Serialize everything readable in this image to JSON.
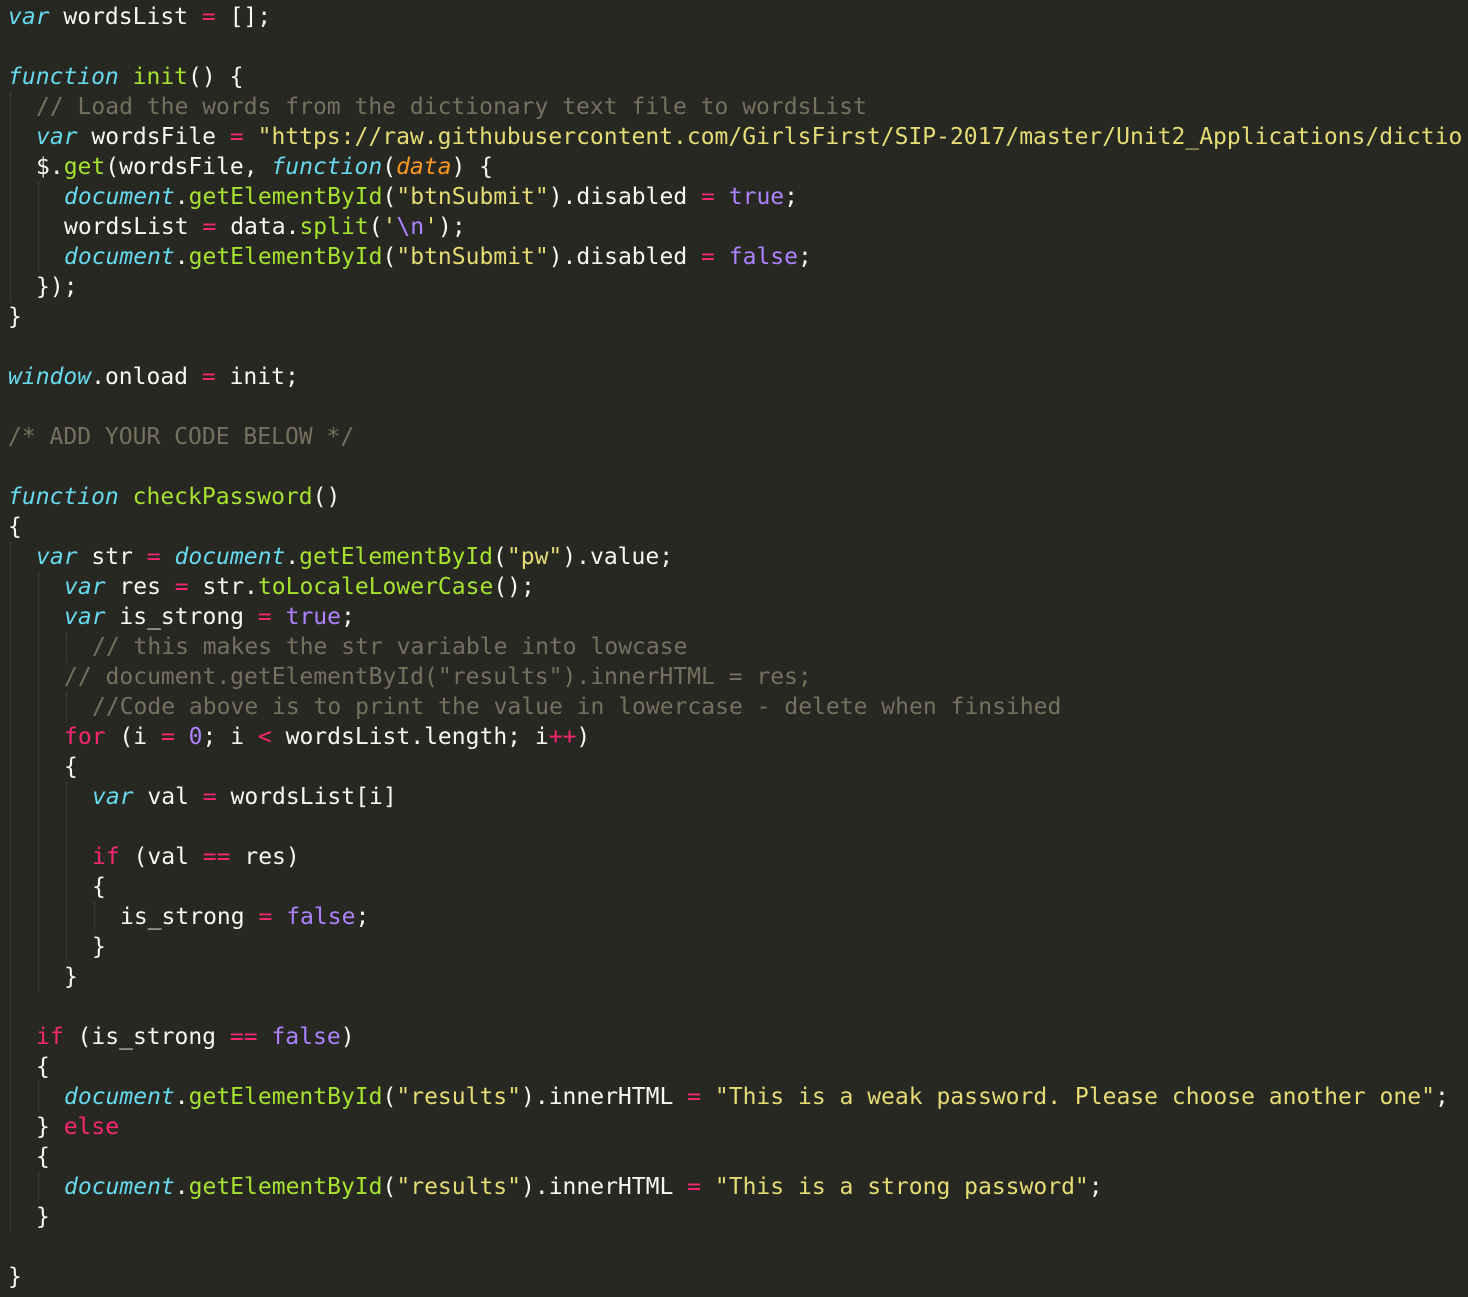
{
  "colors": {
    "background": "#272822",
    "text": "#F8F8F2",
    "storage": "#66D9EF",
    "function_name": "#A6E22E",
    "operator": "#F92672",
    "string": "#E6DB74",
    "constant": "#AE81FF",
    "comment": "#75715E",
    "parameter": "#FD971F"
  },
  "editor": {
    "lines": [
      {
        "indent": 0,
        "tokens": [
          {
            "t": "kw",
            "v": "var"
          },
          {
            "t": "plain",
            "v": " wordsList "
          },
          {
            "t": "op",
            "v": "="
          },
          {
            "t": "plain",
            "v": " [];"
          }
        ]
      },
      {
        "indent": 0,
        "tokens": []
      },
      {
        "indent": 0,
        "tokens": [
          {
            "t": "kw",
            "v": "function"
          },
          {
            "t": "plain",
            "v": " "
          },
          {
            "t": "fn",
            "v": "init"
          },
          {
            "t": "plain",
            "v": "() {"
          }
        ]
      },
      {
        "indent": 1,
        "tokens": [
          {
            "t": "cm",
            "v": "// Load the words from the dictionary text file to wordsList"
          }
        ]
      },
      {
        "indent": 1,
        "tokens": [
          {
            "t": "kw",
            "v": "var"
          },
          {
            "t": "plain",
            "v": " wordsFile "
          },
          {
            "t": "op",
            "v": "="
          },
          {
            "t": "plain",
            "v": " "
          },
          {
            "t": "str",
            "v": "\"https://raw.githubusercontent.com/GirlsFirst/SIP-2017/master/Unit2_Applications/dictio"
          }
        ]
      },
      {
        "indent": 1,
        "tokens": [
          {
            "t": "plain",
            "v": "$."
          },
          {
            "t": "fn",
            "v": "get"
          },
          {
            "t": "plain",
            "v": "(wordsFile, "
          },
          {
            "t": "kw",
            "v": "function"
          },
          {
            "t": "plain",
            "v": "("
          },
          {
            "t": "par",
            "v": "data"
          },
          {
            "t": "plain",
            "v": ") {"
          }
        ]
      },
      {
        "indent": 2,
        "tokens": [
          {
            "t": "kw",
            "v": "document"
          },
          {
            "t": "plain",
            "v": "."
          },
          {
            "t": "fn",
            "v": "getElementById"
          },
          {
            "t": "plain",
            "v": "("
          },
          {
            "t": "str",
            "v": "\"btnSubmit\""
          },
          {
            "t": "plain",
            "v": ").disabled "
          },
          {
            "t": "op",
            "v": "="
          },
          {
            "t": "plain",
            "v": " "
          },
          {
            "t": "num",
            "v": "true"
          },
          {
            "t": "plain",
            "v": ";"
          }
        ]
      },
      {
        "indent": 2,
        "tokens": [
          {
            "t": "plain",
            "v": "wordsList "
          },
          {
            "t": "op",
            "v": "="
          },
          {
            "t": "plain",
            "v": " data."
          },
          {
            "t": "fn",
            "v": "split"
          },
          {
            "t": "plain",
            "v": "("
          },
          {
            "t": "str",
            "v": "'"
          },
          {
            "t": "num",
            "v": "\\n"
          },
          {
            "t": "str",
            "v": "'"
          },
          {
            "t": "plain",
            "v": ");"
          }
        ]
      },
      {
        "indent": 2,
        "tokens": [
          {
            "t": "kw",
            "v": "document"
          },
          {
            "t": "plain",
            "v": "."
          },
          {
            "t": "fn",
            "v": "getElementById"
          },
          {
            "t": "plain",
            "v": "("
          },
          {
            "t": "str",
            "v": "\"btnSubmit\""
          },
          {
            "t": "plain",
            "v": ").disabled "
          },
          {
            "t": "op",
            "v": "="
          },
          {
            "t": "plain",
            "v": " "
          },
          {
            "t": "num",
            "v": "false"
          },
          {
            "t": "plain",
            "v": ";"
          }
        ]
      },
      {
        "indent": 1,
        "tokens": [
          {
            "t": "plain",
            "v": "});"
          }
        ]
      },
      {
        "indent": 0,
        "tokens": [
          {
            "t": "plain",
            "v": "}"
          }
        ]
      },
      {
        "indent": 0,
        "tokens": []
      },
      {
        "indent": 0,
        "tokens": [
          {
            "t": "kw",
            "v": "window"
          },
          {
            "t": "plain",
            "v": ".onload "
          },
          {
            "t": "op",
            "v": "="
          },
          {
            "t": "plain",
            "v": " init;"
          }
        ]
      },
      {
        "indent": 0,
        "tokens": []
      },
      {
        "indent": 0,
        "tokens": [
          {
            "t": "cm",
            "v": "/* ADD YOUR CODE BELOW */"
          }
        ]
      },
      {
        "indent": 0,
        "tokens": []
      },
      {
        "indent": 0,
        "tokens": [
          {
            "t": "kw",
            "v": "function"
          },
          {
            "t": "plain",
            "v": " "
          },
          {
            "t": "fn",
            "v": "checkPassword"
          },
          {
            "t": "plain",
            "v": "()"
          }
        ]
      },
      {
        "indent": 0,
        "tokens": [
          {
            "t": "plain",
            "v": "{"
          }
        ]
      },
      {
        "indent": 1,
        "tokens": [
          {
            "t": "kw",
            "v": "var"
          },
          {
            "t": "plain",
            "v": " str "
          },
          {
            "t": "op",
            "v": "="
          },
          {
            "t": "plain",
            "v": " "
          },
          {
            "t": "kw",
            "v": "document"
          },
          {
            "t": "plain",
            "v": "."
          },
          {
            "t": "fn",
            "v": "getElementById"
          },
          {
            "t": "plain",
            "v": "("
          },
          {
            "t": "str",
            "v": "\"pw\""
          },
          {
            "t": "plain",
            "v": ").value;"
          }
        ]
      },
      {
        "indent": 2,
        "tokens": [
          {
            "t": "kw",
            "v": "var"
          },
          {
            "t": "plain",
            "v": " res "
          },
          {
            "t": "op",
            "v": "="
          },
          {
            "t": "plain",
            "v": " str."
          },
          {
            "t": "fn",
            "v": "toLocaleLowerCase"
          },
          {
            "t": "plain",
            "v": "();"
          }
        ]
      },
      {
        "indent": 2,
        "tokens": [
          {
            "t": "kw",
            "v": "var"
          },
          {
            "t": "plain",
            "v": " is_strong "
          },
          {
            "t": "op",
            "v": "="
          },
          {
            "t": "plain",
            "v": " "
          },
          {
            "t": "num",
            "v": "true"
          },
          {
            "t": "plain",
            "v": ";"
          }
        ]
      },
      {
        "indent": 3,
        "tokens": [
          {
            "t": "cm",
            "v": "// this makes the str variable into lowcase"
          }
        ]
      },
      {
        "indent": 2,
        "tokens": [
          {
            "t": "cm",
            "v": "// document.getElementById(\"results\").innerHTML = res;"
          }
        ]
      },
      {
        "indent": 3,
        "tokens": [
          {
            "t": "cm",
            "v": "//Code above is to print the value in lowercase - delete when finsihed"
          }
        ]
      },
      {
        "indent": 2,
        "tokens": [
          {
            "t": "op",
            "v": "for"
          },
          {
            "t": "plain",
            "v": " (i "
          },
          {
            "t": "op",
            "v": "="
          },
          {
            "t": "plain",
            "v": " "
          },
          {
            "t": "num",
            "v": "0"
          },
          {
            "t": "plain",
            "v": "; i "
          },
          {
            "t": "op",
            "v": "<"
          },
          {
            "t": "plain",
            "v": " wordsList.length; i"
          },
          {
            "t": "op",
            "v": "++"
          },
          {
            "t": "plain",
            "v": ")"
          }
        ]
      },
      {
        "indent": 2,
        "tokens": [
          {
            "t": "plain",
            "v": "{"
          }
        ]
      },
      {
        "indent": 3,
        "tokens": [
          {
            "t": "kw",
            "v": "var"
          },
          {
            "t": "plain",
            "v": " val "
          },
          {
            "t": "op",
            "v": "="
          },
          {
            "t": "plain",
            "v": " wordsList[i]"
          }
        ]
      },
      {
        "indent": 0,
        "tokens": []
      },
      {
        "indent": 3,
        "tokens": [
          {
            "t": "op",
            "v": "if"
          },
          {
            "t": "plain",
            "v": " (val "
          },
          {
            "t": "op",
            "v": "=="
          },
          {
            "t": "plain",
            "v": " res)"
          }
        ]
      },
      {
        "indent": 3,
        "tokens": [
          {
            "t": "plain",
            "v": "{"
          }
        ]
      },
      {
        "indent": 4,
        "tokens": [
          {
            "t": "plain",
            "v": "is_strong "
          },
          {
            "t": "op",
            "v": "="
          },
          {
            "t": "plain",
            "v": " "
          },
          {
            "t": "num",
            "v": "false"
          },
          {
            "t": "plain",
            "v": ";"
          }
        ]
      },
      {
        "indent": 3,
        "tokens": [
          {
            "t": "plain",
            "v": "}"
          }
        ]
      },
      {
        "indent": 2,
        "tokens": [
          {
            "t": "plain",
            "v": "}"
          }
        ]
      },
      {
        "indent": 0,
        "tokens": []
      },
      {
        "indent": 1,
        "tokens": [
          {
            "t": "op",
            "v": "if"
          },
          {
            "t": "plain",
            "v": " (is_strong "
          },
          {
            "t": "op",
            "v": "=="
          },
          {
            "t": "plain",
            "v": " "
          },
          {
            "t": "num",
            "v": "false"
          },
          {
            "t": "plain",
            "v": ")"
          }
        ]
      },
      {
        "indent": 1,
        "tokens": [
          {
            "t": "plain",
            "v": "{"
          }
        ]
      },
      {
        "indent": 2,
        "tokens": [
          {
            "t": "kw",
            "v": "document"
          },
          {
            "t": "plain",
            "v": "."
          },
          {
            "t": "fn",
            "v": "getElementById"
          },
          {
            "t": "plain",
            "v": "("
          },
          {
            "t": "str",
            "v": "\"results\""
          },
          {
            "t": "plain",
            "v": ").innerHTML "
          },
          {
            "t": "op",
            "v": "="
          },
          {
            "t": "plain",
            "v": " "
          },
          {
            "t": "str",
            "v": "\"This is a weak password. Please choose another one\""
          },
          {
            "t": "plain",
            "v": ";"
          }
        ]
      },
      {
        "indent": 1,
        "tokens": [
          {
            "t": "plain",
            "v": "} "
          },
          {
            "t": "op",
            "v": "else"
          }
        ]
      },
      {
        "indent": 1,
        "tokens": [
          {
            "t": "plain",
            "v": "{"
          }
        ]
      },
      {
        "indent": 2,
        "tokens": [
          {
            "t": "kw",
            "v": "document"
          },
          {
            "t": "plain",
            "v": "."
          },
          {
            "t": "fn",
            "v": "getElementById"
          },
          {
            "t": "plain",
            "v": "("
          },
          {
            "t": "str",
            "v": "\"results\""
          },
          {
            "t": "plain",
            "v": ").innerHTML "
          },
          {
            "t": "op",
            "v": "="
          },
          {
            "t": "plain",
            "v": " "
          },
          {
            "t": "str",
            "v": "\"This is a strong password\""
          },
          {
            "t": "plain",
            "v": ";"
          }
        ]
      },
      {
        "indent": 1,
        "tokens": [
          {
            "t": "plain",
            "v": "}"
          }
        ]
      },
      {
        "indent": 0,
        "tokens": []
      },
      {
        "indent": 0,
        "tokens": [
          {
            "t": "plain",
            "v": "}"
          }
        ]
      }
    ]
  }
}
